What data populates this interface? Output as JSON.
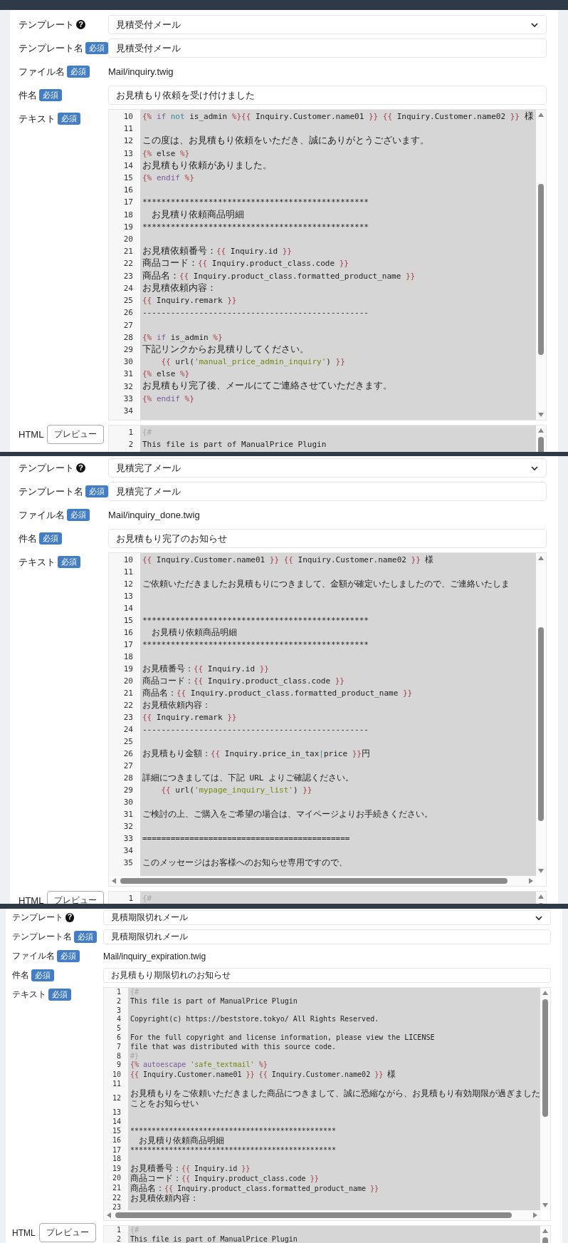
{
  "panels": [
    {
      "rows": [
        {
          "kind": "select",
          "label": "テンプレート",
          "help": "?",
          "value": "見積受付メール"
        },
        {
          "kind": "input",
          "label": "テンプレート名",
          "badge": "必須",
          "value": "見積受付メール"
        },
        {
          "kind": "static",
          "label": "ファイル名",
          "badge": "必須",
          "value": "Mail/inquiry.twig"
        },
        {
          "kind": "input",
          "label": "件名",
          "badge": "必須",
          "value": "お見積もり依頼を受け付けました"
        },
        {
          "kind": "editor",
          "label": "テキスト",
          "badge": "必須",
          "lines": [
            {
              "number": "10",
              "segments": [
                {
                  "kind": "delim",
                  "text": "{% "
                },
                {
                  "kind": "keyword",
                  "text": "if "
                },
                {
                  "kind": "operator",
                  "text": "not"
                },
                {
                  "kind": "plain",
                  "text": " is_admin "
                },
                {
                  "kind": "delim",
                  "text": "%}{{"
                },
                {
                  "kind": "plain",
                  "text": " Inquiry.Customer.name01 "
                },
                {
                  "kind": "delim",
                  "text": "}} {{"
                },
                {
                  "kind": "plain",
                  "text": " Inquiry.Customer.name02 "
                },
                {
                  "kind": "delim",
                  "text": "}}"
                },
                {
                  "kind": "plain",
                  "text": " 様"
                }
              ]
            },
            {
              "number": "11"
            },
            {
              "number": "12",
              "segments": [
                {
                  "kind": "plain",
                  "text": "この度は、お見積もり依頼をいただき、誠にありがとうございます。"
                }
              ]
            },
            {
              "number": "13",
              "segments": [
                {
                  "kind": "delim",
                  "text": "{% "
                },
                {
                  "kind": "plain",
                  "text": "else "
                },
                {
                  "kind": "delim",
                  "text": "%}"
                }
              ]
            },
            {
              "number": "14",
              "segments": [
                {
                  "kind": "plain",
                  "text": "お見積もり依頼がありました。"
                }
              ]
            },
            {
              "number": "15",
              "segments": [
                {
                  "kind": "delim",
                  "text": "{% "
                },
                {
                  "kind": "keyword",
                  "text": "endif"
                },
                {
                  "kind": "delim",
                  "text": " %}"
                }
              ]
            },
            {
              "number": "16"
            },
            {
              "number": "17",
              "segments": [
                {
                  "kind": "plain",
                  "text": "************************************************"
                }
              ]
            },
            {
              "number": "18",
              "segments": [
                {
                  "kind": "plain",
                  "text": "  お見積り依頼商品明細"
                }
              ]
            },
            {
              "number": "19",
              "segments": [
                {
                  "kind": "plain",
                  "text": "************************************************"
                }
              ]
            },
            {
              "number": "20"
            },
            {
              "number": "21",
              "segments": [
                {
                  "kind": "plain",
                  "text": "お見積依頼番号："
                },
                {
                  "kind": "delim",
                  "text": "{{"
                },
                {
                  "kind": "plain",
                  "text": " Inquiry.id "
                },
                {
                  "kind": "delim",
                  "text": "}}"
                }
              ]
            },
            {
              "number": "22",
              "segments": [
                {
                  "kind": "plain",
                  "text": "商品コード："
                },
                {
                  "kind": "delim",
                  "text": "{{"
                },
                {
                  "kind": "plain",
                  "text": " Inquiry.product_class.code "
                },
                {
                  "kind": "delim",
                  "text": "}}"
                }
              ]
            },
            {
              "number": "23",
              "segments": [
                {
                  "kind": "plain",
                  "text": "商品名："
                },
                {
                  "kind": "delim",
                  "text": "{{"
                },
                {
                  "kind": "plain",
                  "text": " Inquiry.product_class.formatted_product_name "
                },
                {
                  "kind": "delim",
                  "text": "}}"
                }
              ]
            },
            {
              "number": "24",
              "segments": [
                {
                  "kind": "plain",
                  "text": "お見積依頼内容："
                }
              ]
            },
            {
              "number": "25",
              "segments": [
                {
                  "kind": "delim",
                  "text": "{{"
                },
                {
                  "kind": "plain",
                  "text": " Inquiry.remark "
                },
                {
                  "kind": "delim",
                  "text": "}}"
                }
              ]
            },
            {
              "number": "26",
              "segments": [
                {
                  "kind": "plain",
                  "text": "------------------------------------------------"
                }
              ]
            },
            {
              "number": "27"
            },
            {
              "number": "28",
              "segments": [
                {
                  "kind": "delim",
                  "text": "{% "
                },
                {
                  "kind": "keyword",
                  "text": "if"
                },
                {
                  "kind": "plain",
                  "text": " is_admin "
                },
                {
                  "kind": "delim",
                  "text": "%}"
                }
              ]
            },
            {
              "number": "29",
              "segments": [
                {
                  "kind": "plain",
                  "text": "下記リンクからお見積りしてください。"
                }
              ]
            },
            {
              "number": "30",
              "segments": [
                {
                  "kind": "delim",
                  "text": "    {{"
                },
                {
                  "kind": "plain",
                  "text": " url("
                },
                {
                  "kind": "string",
                  "text": "'manual_price_admin_inquiry'"
                },
                {
                  "kind": "plain",
                  "text": ") "
                },
                {
                  "kind": "delim",
                  "text": "}}"
                }
              ]
            },
            {
              "number": "31",
              "segments": [
                {
                  "kind": "delim",
                  "text": "{% "
                },
                {
                  "kind": "plain",
                  "text": "else "
                },
                {
                  "kind": "delim",
                  "text": "%}"
                }
              ]
            },
            {
              "number": "32",
              "segments": [
                {
                  "kind": "plain",
                  "text": "お見積もり完了後、メールにてご連絡させていただきます。"
                }
              ]
            },
            {
              "number": "33",
              "segments": [
                {
                  "kind": "delim",
                  "text": "{% "
                },
                {
                  "kind": "keyword",
                  "text": "endif"
                },
                {
                  "kind": "delim",
                  "text": " %}"
                }
              ]
            },
            {
              "number": "34"
            }
          ]
        },
        {
          "kind": "editor",
          "label": "HTML",
          "button": "プレビュー",
          "lines": [
            {
              "number": "1",
              "segments": [
                {
                  "kind": "comment",
                  "text": "{#"
                }
              ]
            },
            {
              "number": "2",
              "segments": [
                {
                  "kind": "plain",
                  "text": "This file is part of ManualPrice Plugin"
                }
              ]
            }
          ]
        }
      ]
    },
    {
      "rows": [
        {
          "kind": "select",
          "label": "テンプレート",
          "help": "?",
          "value": "見積完了メール"
        },
        {
          "kind": "input",
          "label": "テンプレート名",
          "badge": "必須",
          "value": "見積完了メール"
        },
        {
          "kind": "static",
          "label": "ファイル名",
          "badge": "必須",
          "value": "Mail/inquiry_done.twig"
        },
        {
          "kind": "input",
          "label": "件名",
          "badge": "必須",
          "value": "お見積もり完了のお知らせ"
        },
        {
          "kind": "editor",
          "label": "テキスト",
          "badge": "必須",
          "lines": [
            {
              "number": "10",
              "segments": [
                {
                  "kind": "delim",
                  "text": "{{"
                },
                {
                  "kind": "plain",
                  "text": " Inquiry.Customer.name01 "
                },
                {
                  "kind": "delim",
                  "text": "}} {{"
                },
                {
                  "kind": "plain",
                  "text": " Inquiry.Customer.name02 "
                },
                {
                  "kind": "delim",
                  "text": "}}"
                },
                {
                  "kind": "plain",
                  "text": " 様"
                }
              ]
            },
            {
              "number": "11"
            },
            {
              "number": "12",
              "segments": [
                {
                  "kind": "plain",
                  "text": "ご依頼いただきましたお見積もりにつきまして、金額が確定いたしましたので、ご連絡いたしま"
                }
              ]
            },
            {
              "number": "13"
            },
            {
              "number": "14"
            },
            {
              "number": "15",
              "segments": [
                {
                  "kind": "plain",
                  "text": "************************************************"
                }
              ]
            },
            {
              "number": "16",
              "segments": [
                {
                  "kind": "plain",
                  "text": "  お見積り依頼商品明細"
                }
              ]
            },
            {
              "number": "17",
              "segments": [
                {
                  "kind": "plain",
                  "text": "************************************************"
                }
              ]
            },
            {
              "number": "18"
            },
            {
              "number": "19",
              "segments": [
                {
                  "kind": "plain",
                  "text": "お見積番号："
                },
                {
                  "kind": "delim",
                  "text": "{{"
                },
                {
                  "kind": "plain",
                  "text": " Inquiry.id "
                },
                {
                  "kind": "delim",
                  "text": "}}"
                }
              ]
            },
            {
              "number": "20",
              "segments": [
                {
                  "kind": "plain",
                  "text": "商品コード："
                },
                {
                  "kind": "delim",
                  "text": "{{"
                },
                {
                  "kind": "plain",
                  "text": " Inquiry.product_class.code "
                },
                {
                  "kind": "delim",
                  "text": "}}"
                }
              ]
            },
            {
              "number": "21",
              "segments": [
                {
                  "kind": "plain",
                  "text": "商品名："
                },
                {
                  "kind": "delim",
                  "text": "{{"
                },
                {
                  "kind": "plain",
                  "text": " Inquiry.product_class.formatted_product_name "
                },
                {
                  "kind": "delim",
                  "text": "}}"
                }
              ]
            },
            {
              "number": "22",
              "segments": [
                {
                  "kind": "plain",
                  "text": "お見積依頼内容："
                }
              ]
            },
            {
              "number": "23",
              "segments": [
                {
                  "kind": "delim",
                  "text": "{{"
                },
                {
                  "kind": "plain",
                  "text": " Inquiry.remark "
                },
                {
                  "kind": "delim",
                  "text": "}}"
                }
              ]
            },
            {
              "number": "24",
              "segments": [
                {
                  "kind": "plain",
                  "text": "------------------------------------------------"
                }
              ]
            },
            {
              "number": "25"
            },
            {
              "number": "26",
              "segments": [
                {
                  "kind": "plain",
                  "text": "お見積もり金額："
                },
                {
                  "kind": "delim",
                  "text": "{{"
                },
                {
                  "kind": "plain",
                  "text": " Inquiry.price_in_tax"
                },
                {
                  "kind": "operator",
                  "text": "|"
                },
                {
                  "kind": "plain",
                  "text": "price "
                },
                {
                  "kind": "delim",
                  "text": "}}"
                },
                {
                  "kind": "plain",
                  "text": "円"
                }
              ]
            },
            {
              "number": "27"
            },
            {
              "number": "28",
              "segments": [
                {
                  "kind": "plain",
                  "text": "詳細につきましては、下記 URL よりご確認ください。"
                }
              ]
            },
            {
              "number": "29",
              "segments": [
                {
                  "kind": "delim",
                  "text": "    {{"
                },
                {
                  "kind": "plain",
                  "text": " url("
                },
                {
                  "kind": "string",
                  "text": "'mypage_inquiry_list'"
                },
                {
                  "kind": "plain",
                  "text": ") "
                },
                {
                  "kind": "delim",
                  "text": "}}"
                }
              ]
            },
            {
              "number": "30"
            },
            {
              "number": "31",
              "segments": [
                {
                  "kind": "plain",
                  "text": "ご検討の上、ご購入をご希望の場合は、マイページよりお手続きください。"
                }
              ]
            },
            {
              "number": "32"
            },
            {
              "number": "33",
              "segments": [
                {
                  "kind": "plain",
                  "text": "============================================"
                }
              ]
            },
            {
              "number": "34"
            },
            {
              "number": "35",
              "segments": [
                {
                  "kind": "plain",
                  "text": "このメッセージはお客様へのお知らせ専用ですので、"
                }
              ]
            }
          ]
        },
        {
          "kind": "editor",
          "label": "HTML",
          "button": "プレビュー",
          "lines": [
            {
              "number": "1",
              "segments": [
                {
                  "kind": "comment",
                  "text": "{#"
                }
              ]
            }
          ]
        }
      ]
    },
    {
      "rows": [
        {
          "kind": "select",
          "label": "テンプレート",
          "help": "?",
          "value": "見積期限切れメール"
        },
        {
          "kind": "input",
          "label": "テンプレート名",
          "badge": "必須",
          "value": "見積期限切れメール"
        },
        {
          "kind": "static",
          "label": "ファイル名",
          "badge": "必須",
          "value": "Mail/inquiry_expiration.twig"
        },
        {
          "kind": "input",
          "label": "件名",
          "badge": "必須",
          "value": "お見積もり期限切れのお知らせ"
        },
        {
          "kind": "editor",
          "label": "テキスト",
          "badge": "必須",
          "lines": [
            {
              "number": "1",
              "segments": [
                {
                  "kind": "comment",
                  "text": "{#"
                }
              ]
            },
            {
              "number": "2",
              "segments": [
                {
                  "kind": "plain",
                  "text": "This file is part of ManualPrice Plugin"
                }
              ]
            },
            {
              "number": "3"
            },
            {
              "number": "4",
              "segments": [
                {
                  "kind": "plain",
                  "text": "Copyright(c) https://beststore.tokyo/ All Rights Reserved."
                }
              ]
            },
            {
              "number": "5"
            },
            {
              "number": "6",
              "segments": [
                {
                  "kind": "plain",
                  "text": "For the full copyright and license information, please view the LICENSE"
                }
              ]
            },
            {
              "number": "7",
              "segments": [
                {
                  "kind": "plain",
                  "text": "file that was distributed with this source code."
                }
              ]
            },
            {
              "number": "8",
              "segments": [
                {
                  "kind": "comment",
                  "text": "#}"
                }
              ]
            },
            {
              "number": "9",
              "segments": [
                {
                  "kind": "delim",
                  "text": "{% "
                },
                {
                  "kind": "keyword",
                  "text": "autoescape "
                },
                {
                  "kind": "string",
                  "text": "'safe_textmail'"
                },
                {
                  "kind": "delim",
                  "text": " %}"
                }
              ]
            },
            {
              "number": "10",
              "segments": [
                {
                  "kind": "delim",
                  "text": "{{"
                },
                {
                  "kind": "plain",
                  "text": " Inquiry.Customer.name01 "
                },
                {
                  "kind": "delim",
                  "text": "}} {{"
                },
                {
                  "kind": "plain",
                  "text": " Inquiry.Customer.name02 "
                },
                {
                  "kind": "delim",
                  "text": "}}"
                },
                {
                  "kind": "plain",
                  "text": " 様"
                }
              ]
            },
            {
              "number": "11"
            },
            {
              "number": "12",
              "segments": [
                {
                  "kind": "plain",
                  "text": "お見積もりをご依頼いただきました商品につきまして、誠に恐縮ながら、お見積もり有効期限が過ぎましたことをお知らせい"
                }
              ]
            },
            {
              "number": "13"
            },
            {
              "number": "14"
            },
            {
              "number": "15",
              "segments": [
                {
                  "kind": "plain",
                  "text": "************************************************"
                }
              ]
            },
            {
              "number": "16",
              "segments": [
                {
                  "kind": "plain",
                  "text": "  お見積り依頼商品明細"
                }
              ]
            },
            {
              "number": "17",
              "segments": [
                {
                  "kind": "plain",
                  "text": "************************************************"
                }
              ]
            },
            {
              "number": "18"
            },
            {
              "number": "19",
              "segments": [
                {
                  "kind": "plain",
                  "text": "お見積番号："
                },
                {
                  "kind": "delim",
                  "text": "{{"
                },
                {
                  "kind": "plain",
                  "text": " Inquiry.id "
                },
                {
                  "kind": "delim",
                  "text": "}}"
                }
              ]
            },
            {
              "number": "20",
              "segments": [
                {
                  "kind": "plain",
                  "text": "商品コード："
                },
                {
                  "kind": "delim",
                  "text": "{{"
                },
                {
                  "kind": "plain",
                  "text": " Inquiry.product_class.code "
                },
                {
                  "kind": "delim",
                  "text": "}}"
                }
              ]
            },
            {
              "number": "21",
              "segments": [
                {
                  "kind": "plain",
                  "text": "商品名："
                },
                {
                  "kind": "delim",
                  "text": "{{"
                },
                {
                  "kind": "plain",
                  "text": " Inquiry.product_class.formatted_product_name "
                },
                {
                  "kind": "delim",
                  "text": "}}"
                }
              ]
            },
            {
              "number": "22",
              "segments": [
                {
                  "kind": "plain",
                  "text": "お見積依頼内容："
                }
              ]
            },
            {
              "number": "23"
            }
          ]
        },
        {
          "kind": "editor",
          "label": "HTML",
          "button": "プレビュー",
          "lines": [
            {
              "number": "1",
              "segments": [
                {
                  "kind": "comment",
                  "text": "{#"
                }
              ]
            },
            {
              "number": "2",
              "segments": [
                {
                  "kind": "plain",
                  "text": "This file is part of ManualPrice Plugin"
                }
              ]
            }
          ]
        }
      ]
    }
  ]
}
